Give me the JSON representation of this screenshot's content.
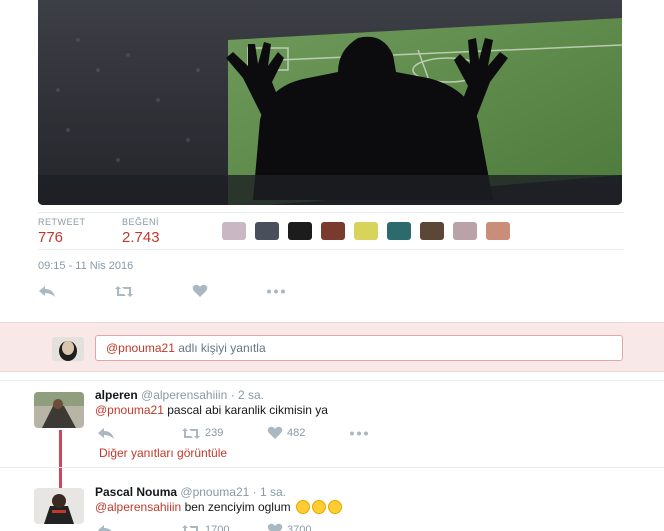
{
  "tweet": {
    "stats": {
      "retweet_label": "RETWEET",
      "retweet_count": "776",
      "like_label": "BEĞENİ",
      "like_count": "2.743"
    },
    "timestamp": "09:15 - 11 Nis 2016",
    "likers": [
      "avatar-1",
      "avatar-2",
      "avatar-3",
      "avatar-4",
      "avatar-5",
      "avatar-6",
      "avatar-7",
      "avatar-8",
      "avatar-9"
    ]
  },
  "reply_box": {
    "mention": "@pnouma21",
    "placeholder_rest": "adlı kişiyi yanıtla"
  },
  "replies": [
    {
      "name": "alperen",
      "handle": "@alperensahiiin",
      "time": "· 2 sa.",
      "mention": "@pnouma21",
      "text": "pascal abi karanlik cikmisin ya",
      "retweets": "239",
      "likes": "482"
    },
    {
      "name": "Pascal Nouma",
      "handle": "@pnouma21",
      "time": "· 1 sa.",
      "mention": "@alperensahiiin",
      "text": "ben zenciyim oglum",
      "retweets": "1700",
      "likes": "3700"
    }
  ],
  "more_replies_link": "Diğer yanıtları görüntüle",
  "colors": {
    "accent": "#c0392b",
    "muted": "#8899a6",
    "icon": "#aab8c2"
  },
  "icons": [
    "reply-icon",
    "retweet-icon",
    "like-icon",
    "more-icon",
    "laughing-emoji-icon"
  ]
}
